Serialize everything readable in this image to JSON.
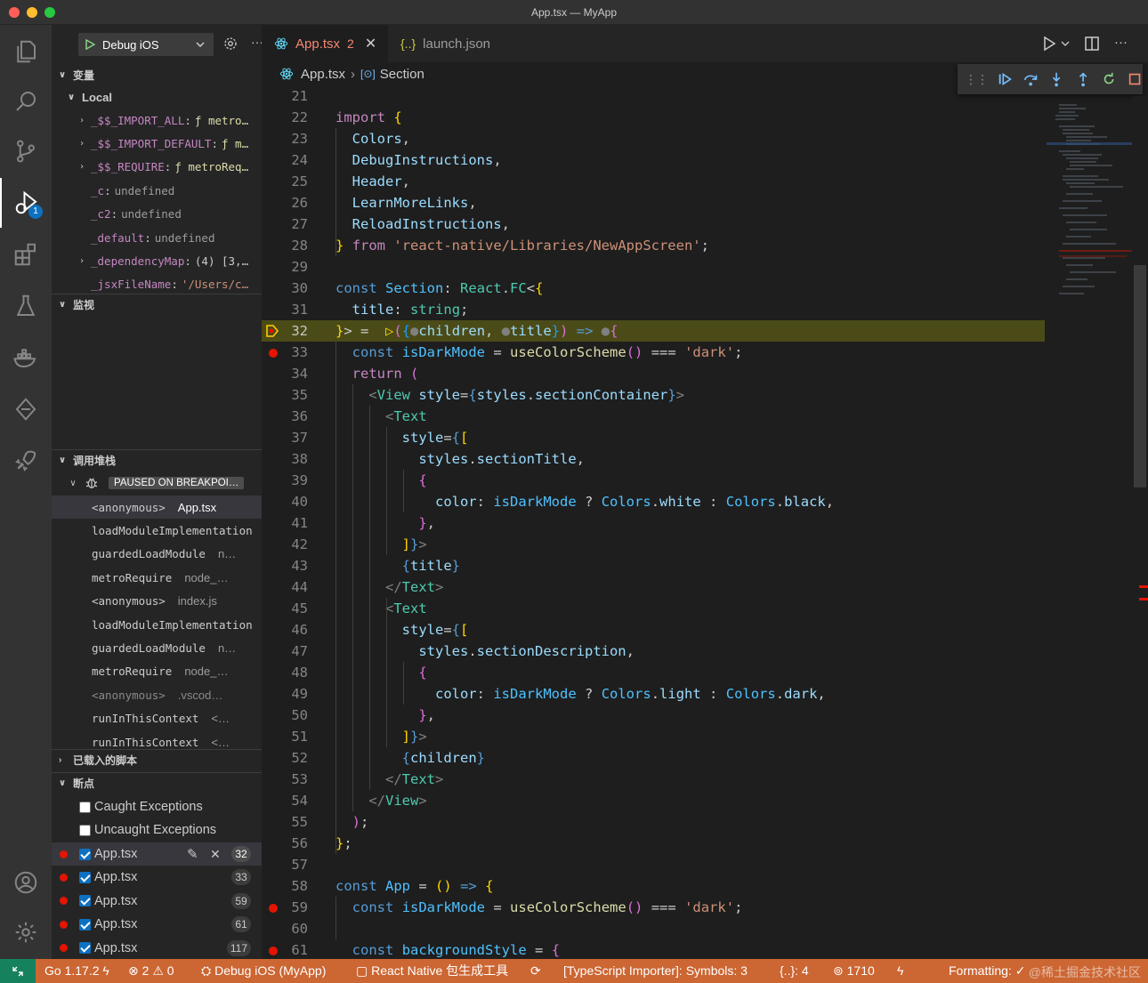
{
  "window": {
    "title": "App.tsx — MyApp"
  },
  "sidebar": {
    "config_label": "Debug iOS",
    "variables_title": "变量",
    "local_title": "Local",
    "variables": [
      {
        "name": "_$$_IMPORT_ALL",
        "value": "ƒ metro…",
        "expandable": true,
        "kind": "func"
      },
      {
        "name": "_$$_IMPORT_DEFAULT",
        "value": "ƒ m…",
        "expandable": true,
        "kind": "func"
      },
      {
        "name": "_$$_REQUIRE",
        "value": "ƒ metroReq…",
        "expandable": true,
        "kind": "func"
      },
      {
        "name": "_c",
        "value": "undefined",
        "expandable": false,
        "kind": "undef"
      },
      {
        "name": "_c2",
        "value": "undefined",
        "expandable": false,
        "kind": "undef"
      },
      {
        "name": "_default",
        "value": "undefined",
        "expandable": false,
        "kind": "undef"
      },
      {
        "name": "_dependencyMap",
        "value": "(4) [3,…",
        "expandable": true,
        "kind": "plain"
      },
      {
        "name": "_jsxFileName",
        "value": "'/Users/c…",
        "expandable": false,
        "kind": "str"
      }
    ],
    "watch_title": "监视",
    "callstack_title": "调用堆栈",
    "paused_label": "PAUSED ON BREAKPOI…",
    "stack": [
      {
        "fn": "<anonymous>",
        "src": "App.tsx"
      },
      {
        "fn": "loadModuleImplementation",
        "src": ""
      },
      {
        "fn": "guardedLoadModule",
        "src": "n…"
      },
      {
        "fn": "metroRequire",
        "src": "node_…"
      },
      {
        "fn": "<anonymous>",
        "src": "index.js"
      },
      {
        "fn": "loadModuleImplementation",
        "src": ""
      },
      {
        "fn": "guardedLoadModule",
        "src": "n…"
      },
      {
        "fn": "metroRequire",
        "src": "node_…"
      },
      {
        "fn": "<anonymous>",
        "src": ".vscod…"
      },
      {
        "fn": "runInThisContext",
        "src": "<…"
      },
      {
        "fn": "runInThisContext",
        "src": "<…"
      }
    ],
    "loaded_scripts_title": "已载入的脚本",
    "breakpoints_title": "断点",
    "exception_options": [
      {
        "label": "Caught Exceptions",
        "checked": false
      },
      {
        "label": "Uncaught Exceptions",
        "checked": false
      }
    ],
    "breakpoints": [
      {
        "file": "App.tsx",
        "line": "32"
      },
      {
        "file": "App.tsx",
        "line": "33"
      },
      {
        "file": "App.tsx",
        "line": "59"
      },
      {
        "file": "App.tsx",
        "line": "61"
      },
      {
        "file": "App.tsx",
        "line": "117"
      }
    ]
  },
  "tabs": [
    {
      "label": "App.tsx",
      "badge": "2",
      "active": true,
      "icon": "react-icon"
    },
    {
      "label": "launch.json",
      "badge": "",
      "active": false,
      "icon": "json-icon"
    }
  ],
  "breadcrumb": {
    "file": "App.tsx",
    "symbol": "Section"
  },
  "code": {
    "lines": [
      {
        "n": "21",
        "html": ""
      },
      {
        "n": "22",
        "html": "<span class='k'>import</span> <span class='y'>{</span>"
      },
      {
        "n": "23",
        "html": "  <span class='v'>Colors</span><span class='p'>,</span>"
      },
      {
        "n": "24",
        "html": "  <span class='v'>DebugInstructions</span><span class='p'>,</span>"
      },
      {
        "n": "25",
        "html": "  <span class='v'>Header</span><span class='p'>,</span>"
      },
      {
        "n": "26",
        "html": "  <span class='v'>LearnMoreLinks</span><span class='p'>,</span>"
      },
      {
        "n": "27",
        "html": "  <span class='v'>ReloadInstructions</span><span class='p'>,</span>"
      },
      {
        "n": "28",
        "html": "<span class='y'>}</span> <span class='k'>from</span> <span class='s'>'react-native/Libraries/NewAppScreen'</span><span class='p'>;</span>"
      },
      {
        "n": "29",
        "html": ""
      },
      {
        "n": "30",
        "html": "<span class='b'>const</span> <span class='c'>Section</span><span class='p'>:</span> <span class='t'>React</span><span class='p'>.</span><span class='t'>FC</span><span class='p'>&lt;</span><span class='y'>{</span>"
      },
      {
        "n": "31",
        "html": "  <span class='v'>title</span><span class='p'>:</span> <span class='t'>string</span><span class='p'>;</span>"
      },
      {
        "n": "32",
        "html": "<span class='y'>}</span><span class='p'>&gt; = </span> <span class='y'>▷</span><span class='m'>(</span><span class='bl'>{</span><span class='gt'>●</span><span class='v'>children</span><span class='p'>, </span><span class='gt'>●</span><span class='v'>title</span><span class='bl'>}</span><span class='m'>)</span> <span class='b'>=&gt;</span> <span class='gt'>●</span><span class='m'>{</span>"
      },
      {
        "n": "33",
        "html": "  <span class='b'>const</span> <span class='c'>isDarkMode</span> <span class='p'>=</span> <span class='f'>useColorScheme</span><span class='m'>()</span> <span class='p'>===</span> <span class='s'>'dark'</span><span class='p'>;</span>"
      },
      {
        "n": "34",
        "html": "  <span class='k'>return</span> <span class='m'>(</span>"
      },
      {
        "n": "35",
        "html": "    <span class='gt'>&lt;</span><span class='tag'>View</span> <span class='v'>style</span><span class='p'>=</span><span class='b'>{</span><span class='v'>styles</span><span class='p'>.</span><span class='v'>sectionContainer</span><span class='b'>}</span><span class='gt'>&gt;</span>"
      },
      {
        "n": "36",
        "html": "      <span class='gt'>&lt;</span><span class='tag'>Text</span>"
      },
      {
        "n": "37",
        "html": "        <span class='v'>style</span><span class='p'>=</span><span class='b'>{</span><span class='y'>[</span>"
      },
      {
        "n": "38",
        "html": "          <span class='v'>styles</span><span class='p'>.</span><span class='v'>sectionTitle</span><span class='p'>,</span>"
      },
      {
        "n": "39",
        "html": "          <span class='m'>{</span>"
      },
      {
        "n": "40",
        "html": "            <span class='v'>color</span><span class='p'>: </span><span class='c'>isDarkMode</span> <span class='p'>?</span> <span class='c'>Colors</span><span class='p'>.</span><span class='v'>white</span> <span class='p'>:</span> <span class='c'>Colors</span><span class='p'>.</span><span class='v'>black</span><span class='p'>,</span>"
      },
      {
        "n": "41",
        "html": "          <span class='m'>}</span><span class='p'>,</span>"
      },
      {
        "n": "42",
        "html": "        <span class='y'>]</span><span class='b'>}</span><span class='gt'>&gt;</span>"
      },
      {
        "n": "43",
        "html": "        <span class='b'>{</span><span class='v'>title</span><span class='b'>}</span>"
      },
      {
        "n": "44",
        "html": "      <span class='gt'>&lt;/</span><span class='tag'>Text</span><span class='gt'>&gt;</span>"
      },
      {
        "n": "45",
        "html": "      <span class='gt'>&lt;</span><span class='tag'>Text</span>"
      },
      {
        "n": "46",
        "html": "        <span class='v'>style</span><span class='p'>=</span><span class='b'>{</span><span class='y'>[</span>"
      },
      {
        "n": "47",
        "html": "          <span class='v'>styles</span><span class='p'>.</span><span class='v'>sectionDescription</span><span class='p'>,</span>"
      },
      {
        "n": "48",
        "html": "          <span class='m'>{</span>"
      },
      {
        "n": "49",
        "html": "            <span class='v'>color</span><span class='p'>: </span><span class='c'>isDarkMode</span> <span class='p'>?</span> <span class='c'>Colors</span><span class='p'>.</span><span class='v'>light</span> <span class='p'>:</span> <span class='c'>Colors</span><span class='p'>.</span><span class='v'>dark</span><span class='p'>,</span>"
      },
      {
        "n": "50",
        "html": "          <span class='m'>}</span><span class='p'>,</span>"
      },
      {
        "n": "51",
        "html": "        <span class='y'>]</span><span class='b'>}</span><span class='gt'>&gt;</span>"
      },
      {
        "n": "52",
        "html": "        <span class='b'>{</span><span class='v'>children</span><span class='b'>}</span>"
      },
      {
        "n": "53",
        "html": "      <span class='gt'>&lt;/</span><span class='tag'>Text</span><span class='gt'>&gt;</span>"
      },
      {
        "n": "54",
        "html": "    <span class='gt'>&lt;/</span><span class='tag'>View</span><span class='gt'>&gt;</span>"
      },
      {
        "n": "55",
        "html": "  <span class='m'>)</span><span class='p'>;</span>"
      },
      {
        "n": "56",
        "html": "<span class='y'>}</span><span class='p'>;</span>"
      },
      {
        "n": "57",
        "html": ""
      },
      {
        "n": "58",
        "html": "<span class='b'>const</span> <span class='c'>App</span> <span class='p'>=</span> <span class='y'>()</span> <span class='b'>=&gt;</span> <span class='y'>{</span>"
      },
      {
        "n": "59",
        "html": "  <span class='b'>const</span> <span class='c'>isDarkMode</span> <span class='p'>=</span> <span class='f'>useColorScheme</span><span class='m'>()</span> <span class='p'>===</span> <span class='s'>'dark'</span><span class='p'>;</span>"
      },
      {
        "n": "60",
        "html": ""
      },
      {
        "n": "61",
        "html": "  <span class='b'>const</span> <span class='c'>backgroundStyle</span> <span class='p'>=</span> <span class='m'>{</span>"
      }
    ],
    "breakpoint_lines": [
      "33",
      "59",
      "61"
    ],
    "current_line": "32"
  },
  "statusbar": {
    "go_version": "Go 1.17.2",
    "errors": "2",
    "warnings": "0",
    "debug_session": "Debug iOS (MyApp)",
    "react_native": "React Native 包生成工具",
    "ts_importer": "[TypeScript Importer]: Symbols: 3",
    "brackets": "{..}: 4",
    "port": "1710",
    "formatting": "Formatting: ✓",
    "watermark": "@稀土掘金技术社区"
  },
  "colors": {
    "statusbar_bg": "#cc6633",
    "current_line_bg": "#4b4b18",
    "breakpoint": "#e51400",
    "accent": "#0e70c0"
  }
}
